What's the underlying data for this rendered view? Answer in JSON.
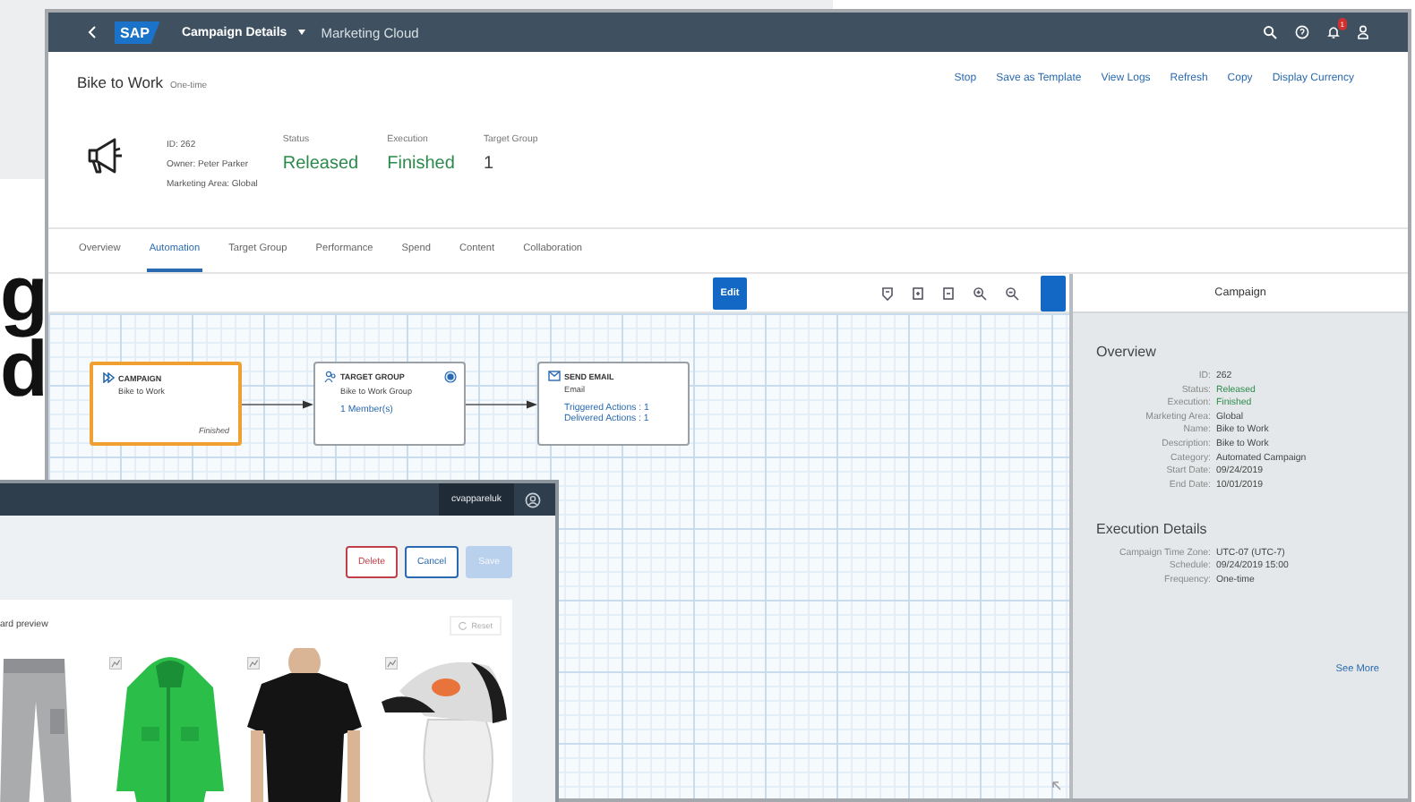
{
  "slide_heading_fragments": [
    "g",
    "d"
  ],
  "main_window": {
    "shell_bar": {
      "logo_text": "SAP",
      "app_title": "Campaign Details",
      "app_subtitle": "Marketing Cloud",
      "notification_count": "1"
    },
    "header": {
      "title": "Bike to Work",
      "type": "One-time",
      "actions": [
        "Stop",
        "Save as Template",
        "View Logs",
        "Refresh",
        "Copy",
        "Display Currency"
      ],
      "info": [
        "ID: 262",
        "Owner: Peter Parker",
        "Marketing Area: Global"
      ],
      "kpis": [
        {
          "label": "Status",
          "value": "Released",
          "kind": "positive"
        },
        {
          "label": "Execution",
          "value": "Finished",
          "kind": "positive"
        },
        {
          "label": "Target Group",
          "value": "1",
          "kind": "neutral"
        }
      ]
    },
    "tabs": [
      {
        "label": "Overview",
        "selected": false
      },
      {
        "label": "Automation",
        "selected": true
      },
      {
        "label": "Target Group",
        "selected": false
      },
      {
        "label": "Performance",
        "selected": false
      },
      {
        "label": "Spend",
        "selected": false
      },
      {
        "label": "Content",
        "selected": false
      },
      {
        "label": "Collaboration",
        "selected": false
      }
    ],
    "toolbar": {
      "edit_button": "Edit"
    },
    "nodes": [
      {
        "kind": "campaign",
        "title": "CAMPAIGN",
        "subtitle": "Bike to Work",
        "status": "Finished",
        "selected": true
      },
      {
        "kind": "target_group",
        "title": "TARGET GROUP",
        "subtitle": "Bike to Work Group",
        "links": [
          "1 Member(s)"
        ],
        "selected": false
      },
      {
        "kind": "send_email",
        "title": "SEND EMAIL",
        "subtitle": "Email",
        "links": [
          "Triggered Actions : 1",
          "Delivered Actions : 1"
        ],
        "selected": false
      }
    ],
    "side_panel": {
      "title": "Campaign",
      "sections": [
        {
          "heading": "Overview",
          "fields": [
            {
              "label": "ID:",
              "value": "262",
              "kind": "neutral"
            },
            {
              "label": "Status:",
              "value": "Released",
              "kind": "positive"
            },
            {
              "label": "Execution:",
              "value": "Finished",
              "kind": "positive"
            },
            {
              "label": "Marketing Area:",
              "value": "Global",
              "kind": "neutral"
            },
            {
              "label": "Name:",
              "value": "Bike to Work",
              "kind": "neutral"
            },
            {
              "label": "Description:",
              "value": "Bike to Work",
              "kind": "neutral"
            },
            {
              "label": "Category:",
              "value": "Automated Campaign",
              "kind": "neutral"
            },
            {
              "label": "Start Date:",
              "value": "09/24/2019",
              "kind": "neutral"
            },
            {
              "label": "End Date:",
              "value": "10/01/2019",
              "kind": "neutral"
            }
          ]
        },
        {
          "heading": "Execution Details",
          "fields": [
            {
              "label": "Campaign Time Zone:",
              "value": "UTC-07 (UTC-7)",
              "kind": "neutral"
            },
            {
              "label": "Schedule:",
              "value": "09/24/2019 15:00",
              "kind": "neutral"
            },
            {
              "label": "Frequency:",
              "value": "One-time",
              "kind": "neutral"
            }
          ]
        }
      ],
      "link": "See More"
    }
  },
  "overlay_window": {
    "user": "cvappareluk",
    "buttons": [
      {
        "label": "Delete",
        "kind": "danger",
        "disabled": false
      },
      {
        "label": "Cancel",
        "kind": "default",
        "disabled": false
      },
      {
        "label": "Save",
        "kind": "primary",
        "disabled": true
      }
    ],
    "card": {
      "title": "ard preview",
      "reset": "Reset",
      "products": [
        {
          "kind": "picture",
          "stats_icon": false
        },
        {
          "kind": "picture",
          "stats_icon": true
        },
        {
          "kind": "picture",
          "stats_icon": true
        },
        {
          "kind": "picture",
          "stats_icon": true
        }
      ]
    }
  }
}
